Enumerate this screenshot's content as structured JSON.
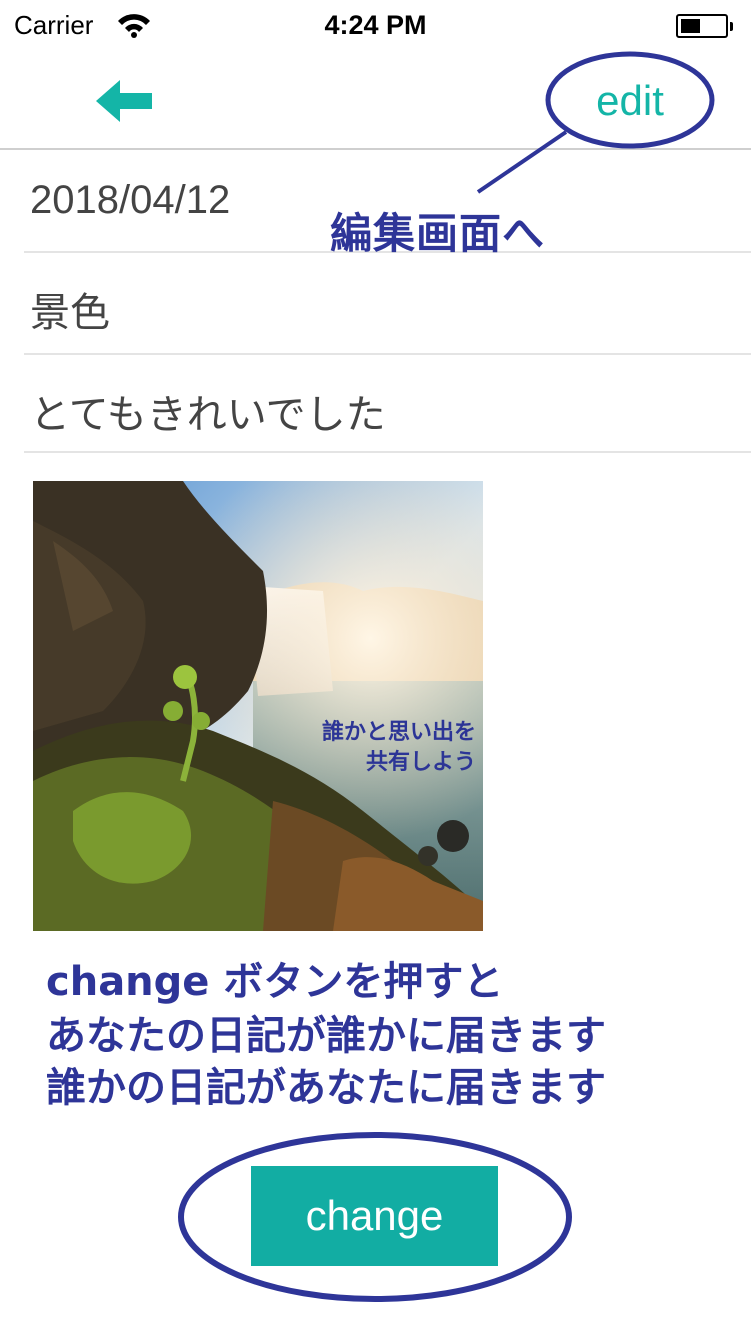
{
  "status_bar": {
    "carrier": "Carrier",
    "time": "4:24 PM",
    "wifi_icon": "wifi-icon",
    "battery_icon": "battery-icon",
    "battery_level": 0.45
  },
  "nav": {
    "back_icon": "arrow-left-icon",
    "edit_label": "edit",
    "accent_color": "#14b5a7"
  },
  "entry": {
    "date": "2018/04/12",
    "title": "景色",
    "body": "とてもきれいでした"
  },
  "photo": {
    "caption_line1": "誰かと思い出を",
    "caption_line2": "共有しよう"
  },
  "annotations": {
    "edit_note": "編集画面へ",
    "change_note_line1": "change ボタンを押すと",
    "change_note_line2": "あなたの日記が誰かに届きます",
    "change_note_line3": "誰かの日記があなたに届きます",
    "annotation_color": "#2e3598"
  },
  "change_button": {
    "label": "change",
    "color": "#12ada3"
  }
}
